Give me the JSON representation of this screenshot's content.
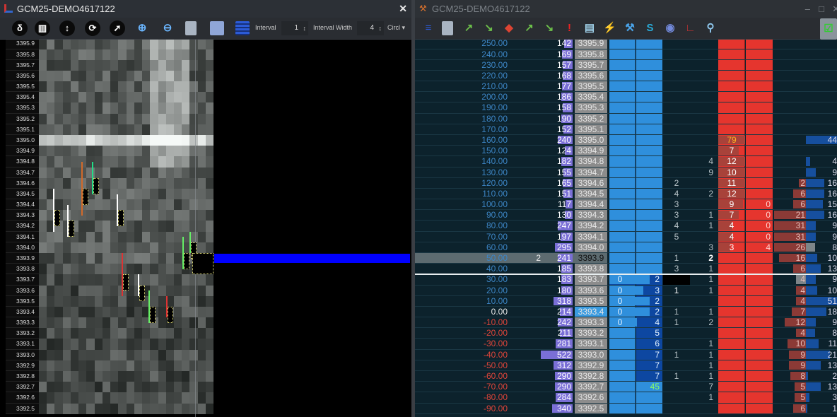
{
  "left_window": {
    "title": "GCM25-DEMO4617122",
    "close": "✕",
    "toolbar": {
      "icons": [
        "delta-icon",
        "bars-icon",
        "updown-icon",
        "refresh-icon",
        "cursor-icon",
        "zoom-in-icon",
        "zoom-out-icon",
        "tooth-icon",
        "grid-icon",
        "ladder-icon"
      ],
      "delta": "δ",
      "interval_label": "Interval",
      "interval_value": "1",
      "interval_width_label": "Interval Width",
      "interval_width_value": "4",
      "shape_select": "Circl ▾"
    },
    "price_axis": [
      "3395.9",
      "3395.8",
      "3395.7",
      "3395.6",
      "3395.5",
      "3395.4",
      "3395.3",
      "3395.2",
      "3395.1",
      "3395.0",
      "3394.9",
      "3394.8",
      "3394.7",
      "3394.6",
      "3394.5",
      "3394.4",
      "3394.3",
      "3394.2",
      "3394.1",
      "3394.0",
      "3393.9",
      "3393.8",
      "3393.7",
      "3393.6",
      "3393.5",
      "3393.4",
      "3393.3",
      "3393.2",
      "3393.1",
      "3393.0",
      "3392.9",
      "3392.8",
      "3392.7",
      "3392.6",
      "3392.5"
    ],
    "current_price_index": 20
  },
  "right_window": {
    "title": "GCM25-DEMO4617122",
    "minimize": "–",
    "maximize": "□",
    "close": "✕",
    "toolbar": {
      "icons": [
        "ladder-icon",
        "tooth-icon",
        "import-icon",
        "export-icon",
        "paint-icon",
        "import2-icon",
        "export2-icon",
        "alert-icon",
        "document-icon",
        "plug-icon",
        "wrench-icon",
        "s-icon",
        "discord-icon",
        "chart-icon",
        "search-icon",
        "checklist-icon"
      ]
    },
    "colors": {
      "bg": "#0c222c",
      "bid": "#2f8fdc",
      "ask": "#e5352e",
      "volume": "#7a6fd6",
      "price": "#8c8c8c"
    },
    "ladder": [
      {
        "pl": "250.00",
        "vol": "142",
        "price": "3395.9"
      },
      {
        "pl": "240.00",
        "vol": "169",
        "price": "3395.8"
      },
      {
        "pl": "230.00",
        "vol": "157",
        "price": "3395.7"
      },
      {
        "pl": "220.00",
        "vol": "168",
        "price": "3395.6"
      },
      {
        "pl": "210.00",
        "vol": "177",
        "price": "3395.5"
      },
      {
        "pl": "200.00",
        "vol": "186",
        "price": "3395.4"
      },
      {
        "pl": "190.00",
        "vol": "158",
        "price": "3395.3"
      },
      {
        "pl": "180.00",
        "vol": "190",
        "price": "3395.2"
      },
      {
        "pl": "170.00",
        "vol": "152",
        "price": "3395.1"
      },
      {
        "pl": "160.00",
        "vol": "240",
        "price": "3395.0",
        "ask1": "79",
        "last": "44"
      },
      {
        "pl": "150.00",
        "vol": "124",
        "price": "3394.9",
        "ask1": "7"
      },
      {
        "pl": "140.00",
        "vol": "182",
        "price": "3394.8",
        "c2": "4",
        "ask1": "12",
        "last": "4"
      },
      {
        "pl": "130.00",
        "vol": "155",
        "price": "3394.7",
        "c2": "9",
        "ask1": "10",
        "last": "9"
      },
      {
        "pl": "120.00",
        "vol": "165",
        "price": "3394.6",
        "c1": "2",
        "ask1": "11",
        "sv": "2",
        "last": "16"
      },
      {
        "pl": "110.00",
        "vol": "151",
        "price": "3394.5",
        "c1": "4",
        "c2": "2",
        "ask1": "12",
        "sv": "6",
        "last": "16"
      },
      {
        "pl": "100.00",
        "vol": "117",
        "price": "3394.4",
        "c1": "3",
        "ask1": "9",
        "ask2": "0",
        "sv": "6",
        "last": "15"
      },
      {
        "pl": "90.00",
        "vol": "130",
        "price": "3394.3",
        "c1": "3",
        "c2": "1",
        "ask1": "7",
        "ask2": "0",
        "sv": "21",
        "last": "16"
      },
      {
        "pl": "80.00",
        "vol": "247",
        "price": "3394.2",
        "c1": "4",
        "c2": "1",
        "ask1": "4",
        "ask2": "0",
        "sv": "31",
        "last": "9"
      },
      {
        "pl": "70.00",
        "vol": "197",
        "price": "3394.1",
        "c1": "5",
        "ask1": "4",
        "ask2": "0",
        "sv": "31",
        "last": "9"
      },
      {
        "pl": "60.00",
        "vol": "295",
        "price": "3394.0",
        "c2": "3",
        "ask1": "3",
        "ask2": "4",
        "sv": "26",
        "last": "8"
      },
      {
        "pl": "50.00",
        "vol": "241",
        "price": "3393.9",
        "pos": "2",
        "c1": "1",
        "c2": "2",
        "sv": "16",
        "last": "10"
      },
      {
        "pl": "40.00",
        "vol": "185",
        "price": "3393.8",
        "c1": "3",
        "c2": "1",
        "sv": "6",
        "last": "13"
      },
      {
        "pl": "30.00",
        "vol": "183",
        "price": "3393.7",
        "bid": "0",
        "bsz": "2",
        "c2": "1",
        "sv": "4",
        "last": "9"
      },
      {
        "pl": "20.00",
        "vol": "180",
        "price": "3393.6",
        "bid": "0",
        "bsz": "3",
        "c1": "1",
        "c2": "1",
        "sv": "4",
        "last": "10"
      },
      {
        "pl": "10.00",
        "vol": "318",
        "price": "3393.5",
        "bid": "0",
        "bsz": "2",
        "sv": "4",
        "last": "51"
      },
      {
        "pl": "0.00",
        "vol": "214",
        "price": "3393.4",
        "bid": "0",
        "bsz": "2",
        "c1": "1",
        "c2": "1",
        "sv": "7",
        "last": "18"
      },
      {
        "pl": "-10.00",
        "vol": "242",
        "price": "3393.3",
        "bid": "0",
        "bsz": "4",
        "c1": "1",
        "c2": "2",
        "sv": "12",
        "last": "9"
      },
      {
        "pl": "-20.00",
        "vol": "211",
        "price": "3393.2",
        "bsz": "5",
        "sv": "4",
        "last": "8"
      },
      {
        "pl": "-30.00",
        "vol": "281",
        "price": "3393.1",
        "bsz": "6",
        "c2": "1",
        "sv": "10",
        "last": "11"
      },
      {
        "pl": "-40.00",
        "vol": "522",
        "price": "3393.0",
        "bsz": "7",
        "c1": "1",
        "c2": "1",
        "sv": "9",
        "last": "21"
      },
      {
        "pl": "-50.00",
        "vol": "312",
        "price": "3392.9",
        "bsz": "7",
        "c2": "1",
        "sv": "9",
        "last": "13"
      },
      {
        "pl": "-60.00",
        "vol": "290",
        "price": "3392.8",
        "bsz": "7",
        "c1": "1",
        "c2": "1",
        "sv": "8",
        "last": "2"
      },
      {
        "pl": "-70.00",
        "vol": "290",
        "price": "3392.7",
        "bsz": "45",
        "c2": "7",
        "sv": "5",
        "last": "13"
      },
      {
        "pl": "-80.00",
        "vol": "284",
        "price": "3392.6",
        "c2": "1",
        "sv": "5",
        "last": "3"
      },
      {
        "pl": "-90.00",
        "vol": "340",
        "price": "3392.5",
        "sv": "6",
        "last": "1"
      }
    ]
  }
}
